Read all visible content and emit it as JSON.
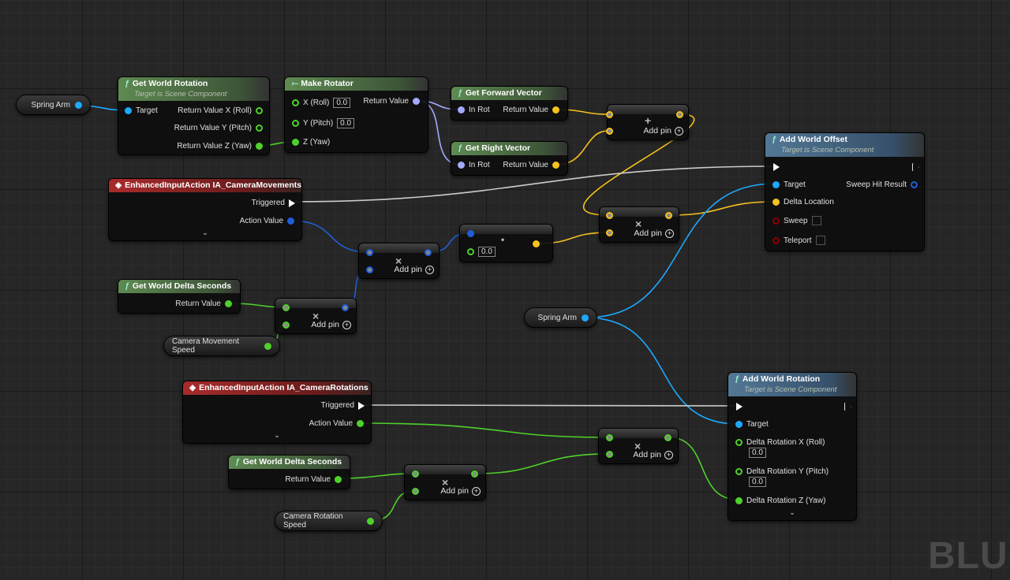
{
  "colors": {
    "exec": "#ffffff",
    "object": "#1ea8ff",
    "float": "#4fd12c",
    "vector": "#f6c21d",
    "rotator": "#a3aaff",
    "bool": "#8b0000",
    "struct": "#1e5fd6",
    "function_header": "#5e8a52",
    "event_header": "#a92b2b",
    "target_header": "#527896"
  },
  "vars": {
    "spring_arm_1": "Spring Arm",
    "spring_arm_2": "Spring Arm",
    "cam_move_speed": "Camera Movement Speed",
    "cam_rot_speed": "Camera Rotation Speed"
  },
  "get_world_rotation": {
    "title": "Get World Rotation",
    "subtitle": "Target is Scene Component",
    "target": "Target",
    "x": "Return Value X (Roll)",
    "y": "Return Value Y (Pitch)",
    "z": "Return Value Z (Yaw)"
  },
  "make_rotator": {
    "title": "Make Rotator",
    "x": "X (Roll)",
    "x_val": "0.0",
    "y": "Y (Pitch)",
    "y_val": "0.0",
    "z": "Z (Yaw)",
    "ret": "Return Value"
  },
  "forward": {
    "title": "Get Forward Vector",
    "in": "In Rot",
    "ret": "Return Value"
  },
  "right": {
    "title": "Get Right Vector",
    "in": "In Rot",
    "ret": "Return Value"
  },
  "add_node": {
    "op": "+",
    "add_pin": "Add pin"
  },
  "add_world_offset": {
    "title": "Add World Offset",
    "subtitle": "Target is Scene Component",
    "target": "Target",
    "delta": "Delta Location",
    "sweep": "Sweep",
    "teleport": "Teleport",
    "hit": "Sweep Hit Result"
  },
  "ia_move": {
    "title": "EnhancedInputAction IA_CameraMovements",
    "triggered": "Triggered",
    "action": "Action Value",
    "expand": "⌄"
  },
  "ia_rot": {
    "title": "EnhancedInputAction IA_CameraRotations",
    "triggered": "Triggered",
    "action": "Action Value",
    "expand": "⌄"
  },
  "mult": {
    "op": "×",
    "add_pin": "Add pin"
  },
  "dot_node": {
    "op": "•",
    "val": "0.0"
  },
  "delta_sec_1": {
    "title": "Get World Delta Seconds",
    "ret": "Return Value"
  },
  "delta_sec_2": {
    "title": "Get World Delta Seconds",
    "ret": "Return Value"
  },
  "add_world_rotation": {
    "title": "Add World Rotation",
    "subtitle": "Target is Scene Component",
    "target": "Target",
    "rx": "Delta Rotation X (Roll)",
    "rx_val": "0.0",
    "ry": "Delta Rotation Y (Pitch)",
    "ry_val": "0.0",
    "rz": "Delta Rotation Z (Yaw)",
    "expand": "⌄"
  },
  "watermark": "BLUE"
}
